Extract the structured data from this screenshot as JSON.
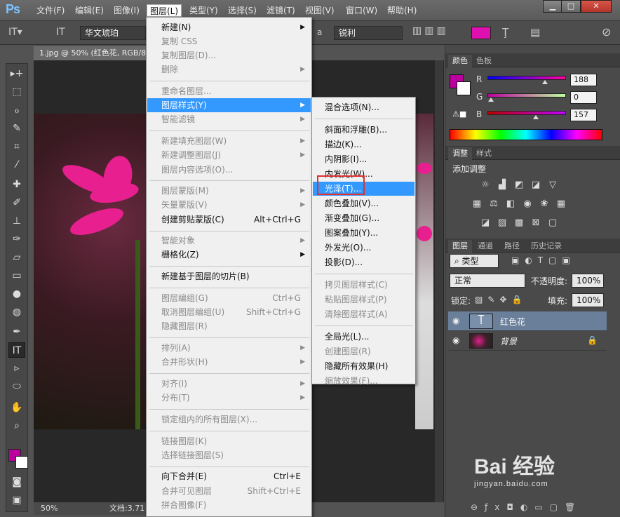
{
  "app": {
    "logo": "Ps"
  },
  "menubar": [
    {
      "label": "文件(F)"
    },
    {
      "label": "编辑(E)"
    },
    {
      "label": "图像(I)"
    },
    {
      "label": "图层(L)"
    },
    {
      "label": "类型(Y)"
    },
    {
      "label": "选择(S)"
    },
    {
      "label": "滤镜(T)"
    },
    {
      "label": "视图(V)"
    },
    {
      "label": "窗口(W)"
    },
    {
      "label": "帮助(H)"
    }
  ],
  "window_buttons": {
    "minimize": "▁",
    "maximize": "□",
    "close": "✕"
  },
  "options": {
    "font_family": "华文琥珀",
    "aa_label": "a",
    "aa_mode": "锐利",
    "color": "#e010b0"
  },
  "document": {
    "tab_title": "1.jpg @ 50% (红色花, RGB/8",
    "zoom": "50%",
    "doc_info": "文档:3.71"
  },
  "layer_menu": {
    "items": [
      {
        "label": "新建(N)",
        "shortcut": "",
        "arrow": true,
        "disabled": false
      },
      {
        "label": "复制 CSS",
        "shortcut": "",
        "arrow": false,
        "disabled": true
      },
      {
        "label": "复制图层(D)...",
        "shortcut": "",
        "arrow": false,
        "disabled": true
      },
      {
        "label": "删除",
        "shortcut": "",
        "arrow": true,
        "disabled": true
      },
      {
        "label": "重命名图层...",
        "shortcut": "",
        "arrow": false,
        "disabled": true
      },
      {
        "label": "图层样式(Y)",
        "shortcut": "",
        "arrow": true,
        "disabled": false
      },
      {
        "label": "智能滤镜",
        "shortcut": "",
        "arrow": true,
        "disabled": true
      },
      {
        "label": "新建填充图层(W)",
        "shortcut": "",
        "arrow": true,
        "disabled": true
      },
      {
        "label": "新建调整图层(J)",
        "shortcut": "",
        "arrow": true,
        "disabled": true
      },
      {
        "label": "图层内容选项(O)...",
        "shortcut": "",
        "arrow": false,
        "disabled": true
      },
      {
        "label": "图层蒙版(M)",
        "shortcut": "",
        "arrow": true,
        "disabled": true
      },
      {
        "label": "矢量蒙版(V)",
        "shortcut": "",
        "arrow": true,
        "disabled": true
      },
      {
        "label": "创建剪贴蒙版(C)",
        "shortcut": "Alt+Ctrl+G",
        "arrow": false,
        "disabled": false
      },
      {
        "label": "智能对象",
        "shortcut": "",
        "arrow": true,
        "disabled": true
      },
      {
        "label": "栅格化(Z)",
        "shortcut": "",
        "arrow": true,
        "disabled": false
      },
      {
        "label": "新建基于图层的切片(B)",
        "shortcut": "",
        "arrow": false,
        "disabled": false
      },
      {
        "label": "图层编组(G)",
        "shortcut": "Ctrl+G",
        "arrow": false,
        "disabled": true
      },
      {
        "label": "取消图层编组(U)",
        "shortcut": "Shift+Ctrl+G",
        "arrow": false,
        "disabled": true
      },
      {
        "label": "隐藏图层(R)",
        "shortcut": "",
        "arrow": false,
        "disabled": true
      },
      {
        "label": "排列(A)",
        "shortcut": "",
        "arrow": true,
        "disabled": true
      },
      {
        "label": "合并形状(H)",
        "shortcut": "",
        "arrow": true,
        "disabled": true
      },
      {
        "label": "对齐(I)",
        "shortcut": "",
        "arrow": true,
        "disabled": true
      },
      {
        "label": "分布(T)",
        "shortcut": "",
        "arrow": true,
        "disabled": true
      },
      {
        "label": "锁定组内的所有图层(X)...",
        "shortcut": "",
        "arrow": false,
        "disabled": true
      },
      {
        "label": "链接图层(K)",
        "shortcut": "",
        "arrow": false,
        "disabled": true
      },
      {
        "label": "选择链接图层(S)",
        "shortcut": "",
        "arrow": false,
        "disabled": true
      },
      {
        "label": "向下合并(E)",
        "shortcut": "Ctrl+E",
        "arrow": false,
        "disabled": false
      },
      {
        "label": "合并可见图层",
        "shortcut": "Shift+Ctrl+E",
        "arrow": false,
        "disabled": true
      },
      {
        "label": "拼合图像(F)",
        "shortcut": "",
        "arrow": false,
        "disabled": true
      }
    ]
  },
  "style_submenu": {
    "items": [
      {
        "label": "混合选项(N)...",
        "disabled": false
      },
      {
        "label": "斜面和浮雕(B)...",
        "disabled": false
      },
      {
        "label": "描边(K)...",
        "disabled": false
      },
      {
        "label": "内阴影(I)...",
        "disabled": false
      },
      {
        "label": "内发光(W)...",
        "disabled": false
      },
      {
        "label": "光泽(T)...",
        "disabled": false
      },
      {
        "label": "颜色叠加(V)...",
        "disabled": false
      },
      {
        "label": "渐变叠加(G)...",
        "disabled": false
      },
      {
        "label": "图案叠加(Y)...",
        "disabled": false
      },
      {
        "label": "外发光(O)...",
        "disabled": false
      },
      {
        "label": "投影(D)...",
        "disabled": false
      },
      {
        "label": "拷贝图层样式(C)",
        "disabled": true
      },
      {
        "label": "粘贴图层样式(P)",
        "disabled": true
      },
      {
        "label": "清除图层样式(A)",
        "disabled": true
      },
      {
        "label": "全局光(L)...",
        "disabled": false
      },
      {
        "label": "创建图层(R)",
        "disabled": true
      },
      {
        "label": "隐藏所有效果(H)",
        "disabled": false
      },
      {
        "label": "缩放效果(F)...",
        "disabled": true
      }
    ]
  },
  "color_panel": {
    "tabs": [
      "颜色",
      "色板"
    ],
    "r_label": "R",
    "g_label": "G",
    "b_label": "B",
    "r": "188",
    "g": "0",
    "b": "157",
    "r_level": 0.737,
    "g_level": 0.0,
    "b_level": 0.616,
    "fg_color": "#bc009d"
  },
  "adjust_panel": {
    "tabs": [
      "调整",
      "样式"
    ],
    "title": "添加调整"
  },
  "layers_panel": {
    "tabs": [
      "图层",
      "通道",
      "路径",
      "历史记录"
    ],
    "filter_kind": "类型",
    "blend_mode": "正常",
    "opacity_label": "不透明度:",
    "opacity": "100%",
    "lock_label": "锁定:",
    "fill_label": "填充:",
    "fill": "100%",
    "layers": [
      {
        "name": "红色花",
        "type": "text",
        "selected": true
      },
      {
        "name": "背景",
        "type": "image",
        "selected": false
      }
    ]
  },
  "watermark": {
    "text": "Bai 经验",
    "sub": "jingyan.baidu.com"
  }
}
